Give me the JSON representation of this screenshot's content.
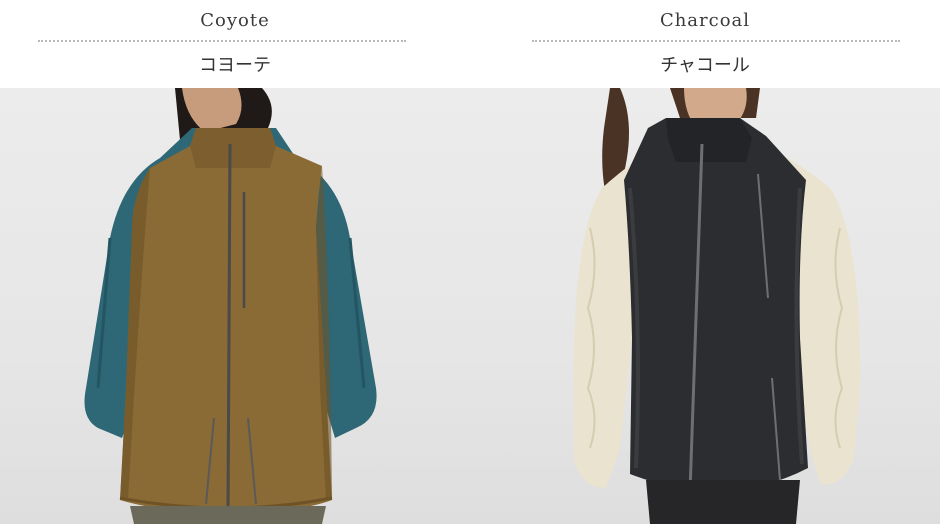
{
  "colors": [
    {
      "name_en": "Coyote",
      "name_jp": "コヨーテ",
      "vest_color": "#8a6a35",
      "inner_color": "#2e6775"
    },
    {
      "name_en": "Charcoal",
      "name_jp": "チャコール",
      "vest_color": "#2b2d30",
      "inner_color": "#eae3cf"
    }
  ]
}
